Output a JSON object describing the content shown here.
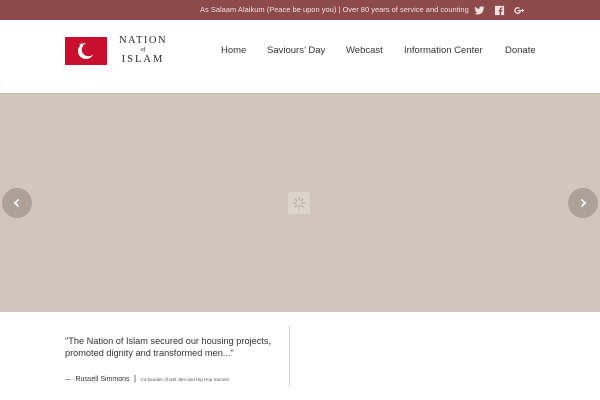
{
  "topbar": {
    "message": "As Salaam Alaikum (Peace be upon you) | Over 80 years of service and counting",
    "social": [
      "twitter-icon",
      "facebook-icon",
      "google-plus-icon"
    ]
  },
  "logo": {
    "line1": "NATION",
    "line2": "of",
    "line3": "ISLAM"
  },
  "nav": {
    "items": [
      "Home",
      "Saviours’ Day",
      "Webcast",
      "Information Center",
      "Donate"
    ]
  },
  "hero": {
    "prev_icon": "chevron-left-icon",
    "next_icon": "chevron-right-icon",
    "loader_icon": "loading-spinner-icon"
  },
  "quote": {
    "text": "\"The Nation of Islam secured our housing projects, promoted dignity and transformed men...\"",
    "dash": "—",
    "author": "Russell Simmons",
    "separator": "|",
    "role": "Co-founder of Def Jam and Hip Hop Summit"
  },
  "colors": {
    "topbar": "#8c4a4a",
    "hero_bg": "#d0c6bc",
    "flag_red": "#c8102e"
  }
}
